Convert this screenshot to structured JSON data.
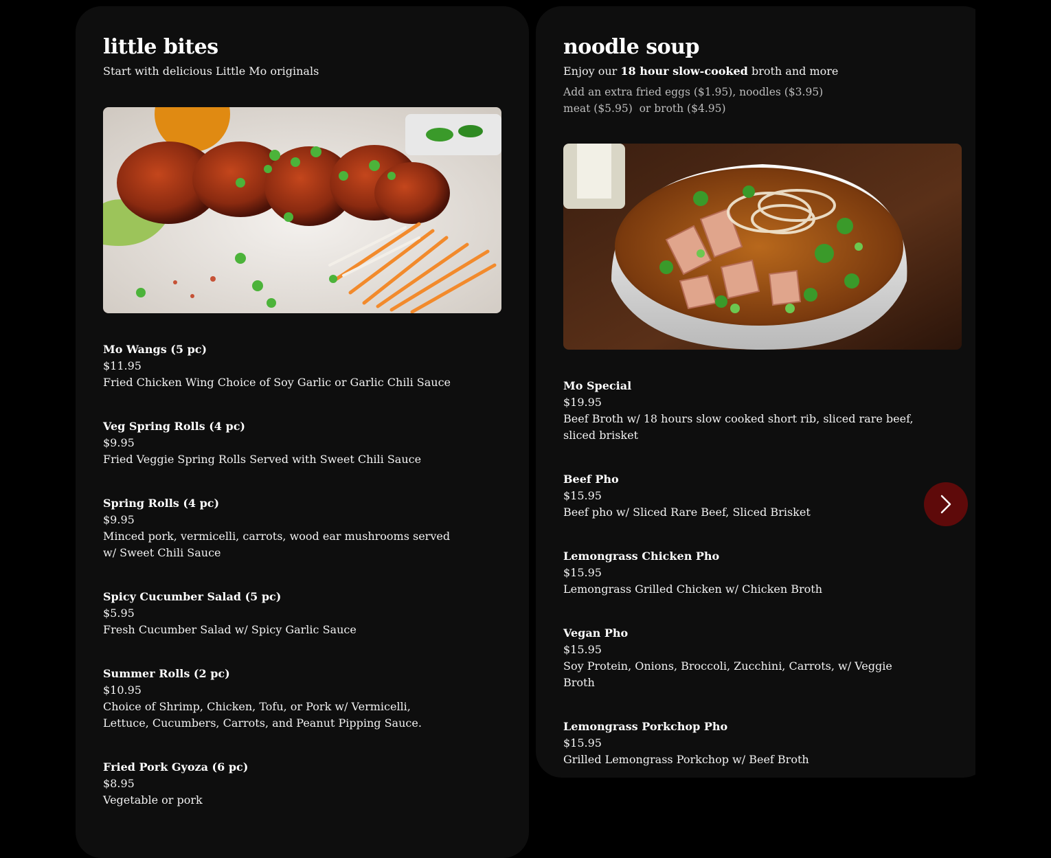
{
  "little_bites": {
    "title": "little bites",
    "subtitle": "Start with delicious Little Mo originals",
    "items": [
      {
        "name": "Mo Wangs (5 pc)",
        "price": "$11.95",
        "desc": "Fried Chicken Wing Choice of Soy Garlic or Garlic Chili Sauce"
      },
      {
        "name": "Veg Spring Rolls (4 pc)",
        "price": "$9.95",
        "desc": "Fried Veggie Spring Rolls Served with Sweet Chili Sauce"
      },
      {
        "name": "Spring Rolls (4 pc)",
        "price": "$9.95",
        "desc": "Minced pork, vermicelli, carrots, wood ear mushrooms served w/ Sweet Chili Sauce"
      },
      {
        "name": "Spicy Cucumber Salad (5 pc)",
        "price": "$5.95",
        "desc": "Fresh Cucumber Salad w/ Spicy Garlic Sauce"
      },
      {
        "name": "Summer Rolls (2 pc)",
        "price": "$10.95",
        "desc": "Choice of Shrimp, Chicken, Tofu, or Pork w/ Vermicelli, Lettuce, Cucumbers, Carrots, and Peanut Pipping Sauce."
      },
      {
        "name": "Fried Pork Gyoza (6 pc)",
        "price": "$8.95",
        "desc": "Vegetable or pork"
      }
    ]
  },
  "noodle_soup": {
    "title": "noodle soup",
    "subtitle_pre": "Enjoy our ",
    "subtitle_bold": "18 hour slow-cooked",
    "subtitle_post": " broth and more",
    "note_line1": "Add an extra fried eggs ($1.95), noodles ($3.95)",
    "note_line2": "meat ($5.95)  or broth ($4.95)",
    "items": [
      {
        "name": "Mo Special",
        "price": "$19.95",
        "desc": "Beef Broth w/ 18 hours slow cooked short rib, sliced rare beef, sliced brisket"
      },
      {
        "name": "Beef Pho",
        "price": "$15.95",
        "desc": "Beef pho w/ Sliced Rare Beef, Sliced Brisket"
      },
      {
        "name": "Lemongrass Chicken Pho",
        "price": "$15.95",
        "desc": "Lemongrass Grilled Chicken w/ Chicken Broth"
      },
      {
        "name": "Vegan Pho",
        "price": "$15.95",
        "desc": "Soy Protein, Onions, Broccoli, Zucchini, Carrots, w/ Veggie Broth"
      },
      {
        "name": "Lemongrass Porkchop Pho",
        "price": "$15.95",
        "desc": "Grilled Lemongrass Porkchop w/ Beef Broth"
      }
    ]
  },
  "carousel": {
    "next_icon": "chevron-right-icon",
    "button_color": "#5e0a0a"
  }
}
